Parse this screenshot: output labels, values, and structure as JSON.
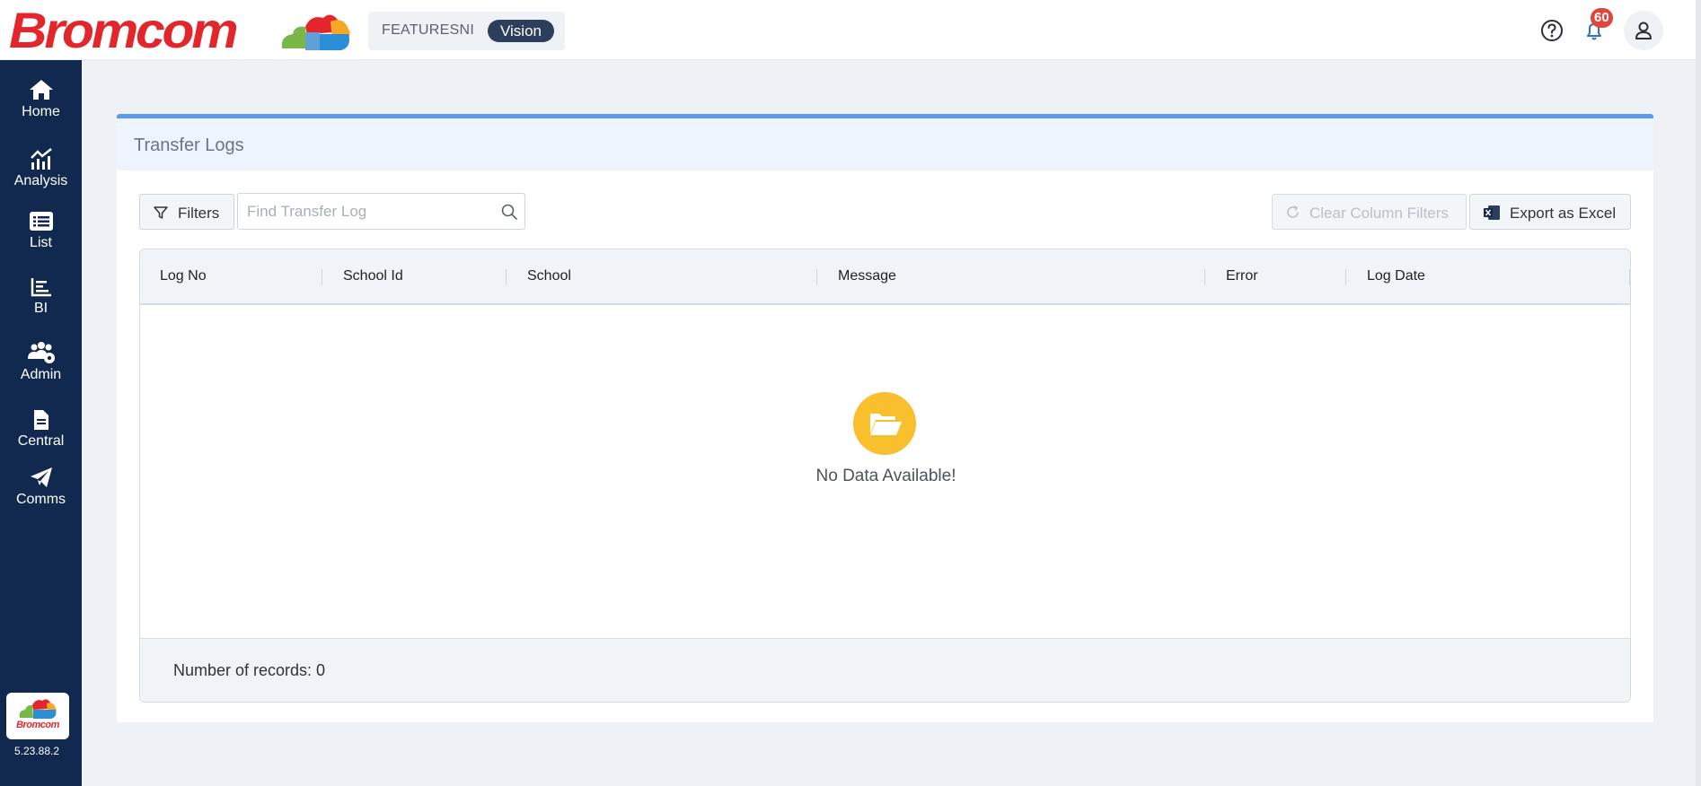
{
  "header": {
    "logo_text": "Bromcom",
    "environment": "FEATURESNI",
    "product_badge": "Vision",
    "notification_count": "60",
    "icons": [
      "help-icon",
      "bell-icon",
      "user-icon"
    ],
    "brand_color": "#e3262b"
  },
  "sidebar": {
    "items": [
      {
        "label": "Home",
        "icon": "home-icon"
      },
      {
        "label": "Analysis",
        "icon": "analysis-icon"
      },
      {
        "label": "List",
        "icon": "list-icon"
      },
      {
        "label": "BI",
        "icon": "bi-icon"
      },
      {
        "label": "Admin",
        "icon": "admin-icon"
      },
      {
        "label": "Central",
        "icon": "document-icon"
      },
      {
        "label": "Comms",
        "icon": "send-icon"
      }
    ],
    "logo_text": "Bromcom",
    "version": "5.23.88.2",
    "background": "#12294f"
  },
  "panel": {
    "title": "Transfer Logs",
    "filters_label": "Filters",
    "search_placeholder": "Find Transfer Log",
    "search_value": "",
    "clear_filters_label": "Clear Column Filters",
    "export_label": "Export as Excel",
    "accent": "#5b9ae6"
  },
  "grid": {
    "columns": [
      "Log No",
      "School Id",
      "School",
      "Message",
      "Error",
      "Log Date"
    ],
    "rows": [],
    "empty_text": "No Data Available!",
    "records_text": "Number of records: 0",
    "empty_icon_color": "#f9c02e"
  }
}
